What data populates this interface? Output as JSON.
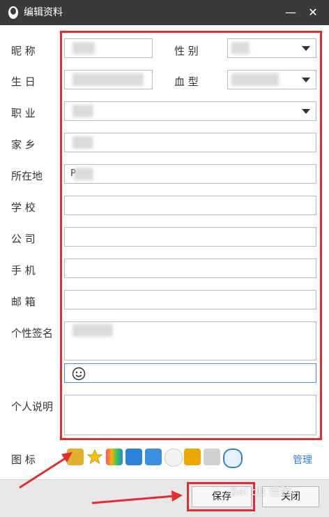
{
  "window": {
    "title": "编辑资料",
    "minimize_glyph": "—",
    "close_glyph": "✕"
  },
  "form": {
    "nickname_label": "昵 称",
    "gender_label": "性 别",
    "birthday_label": "生 日",
    "blood_label": "血 型",
    "job_label": "职 业",
    "hometown_label": "家 乡",
    "location_label": "所在地",
    "school_label": "学 校",
    "company_label": "公 司",
    "phone_label": "手 机",
    "email_label": "邮 箱",
    "signature_label": "个性签名",
    "personal_desc_label": "个人说明",
    "icons_label": "图 标",
    "location_value": "P"
  },
  "actions": {
    "manage": "管理",
    "save": "保存",
    "close": "关闭"
  },
  "watermark": {
    "text": "Bai du 经验"
  },
  "colors": {
    "titlebar": "#3a3a3a",
    "annotation_red": "#e12d2d",
    "link_blue": "#2b83d8",
    "field_border": "#b9b9b9",
    "emoji_border": "#4a8fd6"
  },
  "icons": [
    "diamond-badge-icon",
    "star-icon",
    "app-icon",
    "camera-icon",
    "cube-icon",
    "webcam-icon",
    "shield-icon",
    "gem-icon",
    "qq-search-icon"
  ]
}
